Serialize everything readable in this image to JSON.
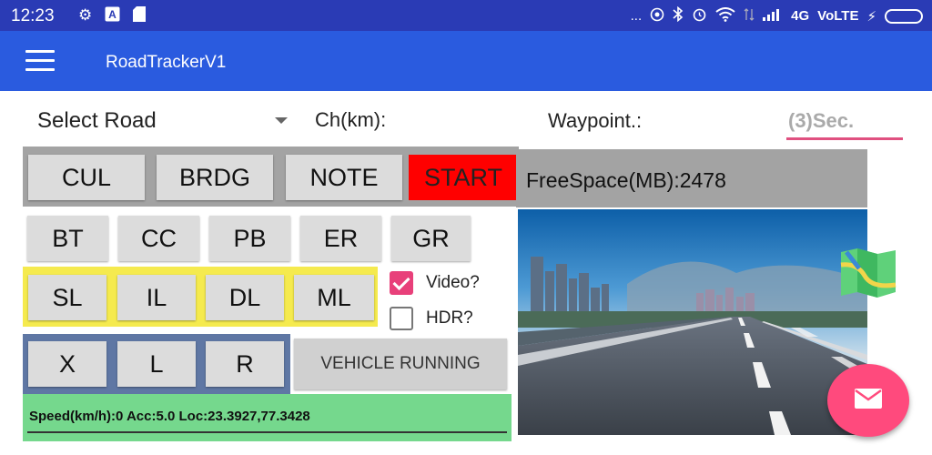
{
  "status_bar": {
    "time": "12:23",
    "network": "4G",
    "carrier": "VoLTE",
    "dots": "..."
  },
  "app_bar": {
    "title": "RoadTrackerV1"
  },
  "form": {
    "select_road": "Select Road",
    "chainage_label": "Ch(km):",
    "waypoint_label": "Waypoint.:",
    "interval_placeholder": "(3)Sec."
  },
  "buttons_row1": {
    "cul": "CUL",
    "brdg": "BRDG",
    "note": "NOTE",
    "start": "START"
  },
  "buttons_row2": {
    "bt": "BT",
    "cc": "CC",
    "pb": "PB",
    "er": "ER",
    "gr": "GR"
  },
  "buttons_row3": {
    "sl": "SL",
    "il": "IL",
    "dl": "DL",
    "ml": "ML"
  },
  "buttons_row4": {
    "x": "X",
    "l": "L",
    "r": "R",
    "vehicle": "VEHICLE RUNNING"
  },
  "options": {
    "video_label": "Video?",
    "video_checked": true,
    "hdr_label": "HDR?",
    "hdr_checked": false
  },
  "info": {
    "telemetry": "Speed(km/h):0 Acc:5.0 Loc:23.3927,77.3428",
    "freespace": "FreeSpace(MB):2478"
  },
  "colors": {
    "status_bar": "#2a3bb5",
    "app_bar": "#2a5bdf",
    "start_button": "#ff0000",
    "accent_pink": "#ff4a7d",
    "info_bar": "#75d88d",
    "yellow_band": "#f5ea4e",
    "blue_band": "#5f77a4",
    "gray_band": "#a3a3a3"
  },
  "icons": {
    "status_left": [
      "gear-icon",
      "font-icon",
      "sd-card-icon"
    ],
    "status_right": [
      "hotspot-icon",
      "bluetooth-icon",
      "alarm-icon",
      "wifi-icon",
      "data-arrows-icon",
      "signal-icon",
      "charging-icon",
      "battery-icon"
    ],
    "menu": "hamburger-menu-icon",
    "map": "map-icon",
    "fab": "mail-icon"
  }
}
